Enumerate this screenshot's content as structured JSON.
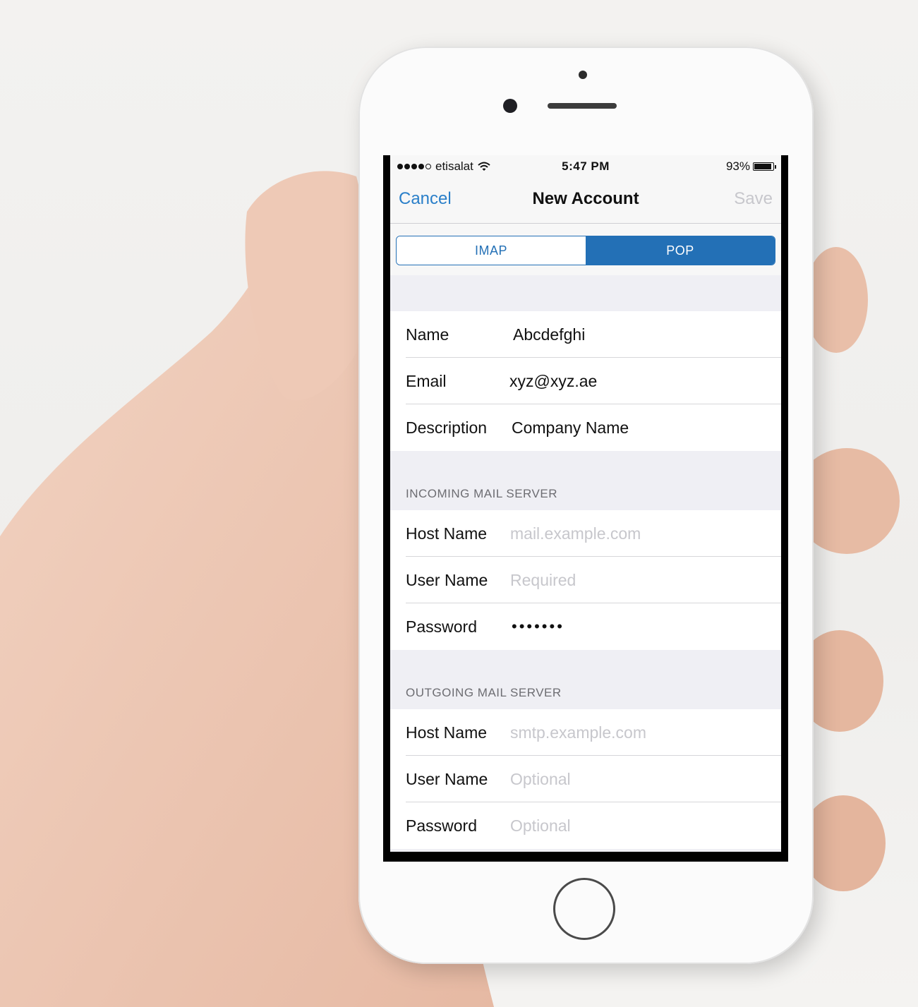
{
  "status_bar": {
    "carrier": "etisalat",
    "time": "5:47 PM",
    "battery": "93%",
    "battery_level": 0.93
  },
  "nav": {
    "cancel": "Cancel",
    "title": "New Account",
    "save": "Save"
  },
  "segments": {
    "imap": "IMAP",
    "pop": "POP",
    "selected": "POP"
  },
  "account": {
    "name_label": "Name",
    "name_value": "Abcdefghi",
    "email_label": "Email",
    "email_value": "xyz@xyz.ae",
    "description_label": "Description",
    "description_value": "Company Name"
  },
  "incoming": {
    "header": "INCOMING MAIL SERVER",
    "host_label": "Host Name",
    "host_placeholder": "mail.example.com",
    "user_label": "User Name",
    "user_placeholder": "Required",
    "password_label": "Password",
    "password_value": "•••••••"
  },
  "outgoing": {
    "header": "OUTGOING MAIL SERVER",
    "host_label": "Host Name",
    "host_placeholder": "smtp.example.com",
    "user_label": "User Name",
    "user_placeholder": "Optional",
    "password_label": "Password",
    "password_placeholder": "Optional"
  },
  "colors": {
    "accent": "#2370b6",
    "link": "#2a7fc9",
    "placeholder": "#c7c7cc",
    "group_bg": "#efeff4"
  }
}
